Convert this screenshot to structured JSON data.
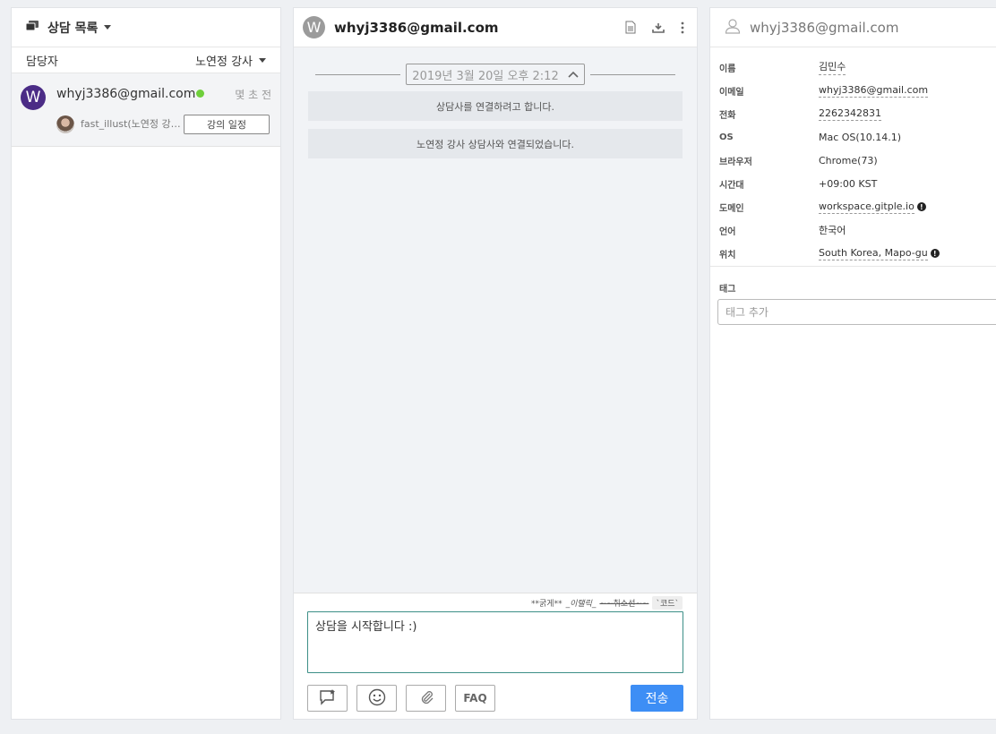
{
  "left": {
    "title": "상담 목록",
    "assignee_label": "담당자",
    "assignee_value": "노연정 강사",
    "chats": [
      {
        "avatar_letter": "W",
        "email": "whyj3386@gmail.com",
        "time": "몇 초 전",
        "agent": "fast_illust(노연정 강사)",
        "schedule_button": "강의 일정"
      }
    ]
  },
  "mid": {
    "avatar_letter": "W",
    "title": "whyj3386@gmail.com",
    "date_pill": "2019년 3월 20일 오후 2:12",
    "system_messages": [
      "상담사를 연결하려고 합니다.",
      "노연정 강사 상담사와 연결되었습니다."
    ],
    "md_hint": {
      "bold": "**굵게**",
      "italic": "_이탤릭_",
      "strike": "~~취소선~~",
      "code": "`코드`"
    },
    "composer_text": "상담을 시작합니다 :)",
    "faq_label": "FAQ",
    "send_label": "전송"
  },
  "right": {
    "email": "whyj3386@gmail.com",
    "rows": [
      {
        "k": "이름",
        "v": "김민수",
        "underline": true,
        "warn": false
      },
      {
        "k": "이메일",
        "v": "whyj3386@gmail.com",
        "underline": true,
        "warn": false
      },
      {
        "k": "전화",
        "v": "2262342831",
        "underline": true,
        "warn": false
      },
      {
        "k": "OS",
        "v": "Mac OS(10.14.1)",
        "underline": false,
        "warn": false
      },
      {
        "k": "브라우저",
        "v": "Chrome(73)",
        "underline": false,
        "warn": false
      },
      {
        "k": "시간대",
        "v": "+09:00 KST",
        "underline": false,
        "warn": false
      },
      {
        "k": "도메인",
        "v": "workspace.gitple.io",
        "underline": true,
        "warn": true
      },
      {
        "k": "언어",
        "v": "한국어",
        "underline": false,
        "warn": false
      },
      {
        "k": "위치",
        "v": "South Korea, Mapo-gu",
        "underline": true,
        "warn": true
      }
    ],
    "tag_label": "태그",
    "tag_placeholder": "태그 추가"
  },
  "colors": {
    "accent": "#3d8ef5",
    "online": "#6fcf3b",
    "avatar": "#4b2c86",
    "focus": "#3c8f87"
  }
}
